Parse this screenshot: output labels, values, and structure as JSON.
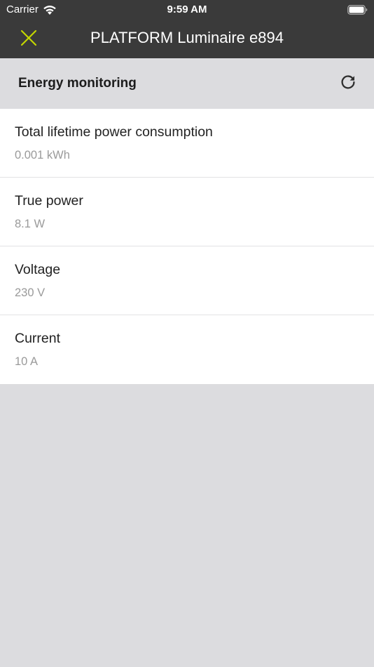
{
  "status_bar": {
    "carrier": "Carrier",
    "time": "9:59 AM",
    "wifi_icon": "wifi-icon",
    "battery_icon": "battery-icon"
  },
  "nav": {
    "close_icon": "close-icon",
    "title": "PLATFORM Luminaire e894",
    "accent_color": "#c4d600"
  },
  "section": {
    "title": "Energy monitoring",
    "refresh_icon": "refresh-icon"
  },
  "metrics": [
    {
      "label": "Total lifetime power consumption",
      "value": "0.001 kWh"
    },
    {
      "label": "True power",
      "value": "8.1 W"
    },
    {
      "label": "Voltage",
      "value": "230 V"
    },
    {
      "label": "Current",
      "value": "10 A"
    }
  ],
  "colors": {
    "topbar_bg": "#3a3a3a",
    "background": "#dcdcdf",
    "label": "#222222",
    "value": "#9a9a9a"
  }
}
